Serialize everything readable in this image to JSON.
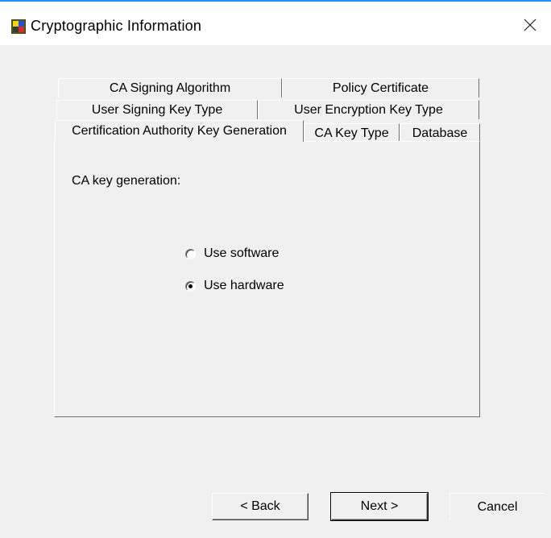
{
  "window": {
    "title": "Cryptographic Information",
    "accent_color": "#1e90ff"
  },
  "tabs": {
    "row1": [
      {
        "label": "CA Signing Algorithm"
      },
      {
        "label": "Policy Certificate"
      }
    ],
    "row2": [
      {
        "label": "User Signing Key Type"
      },
      {
        "label": "User Encryption Key Type"
      }
    ],
    "row3": [
      {
        "label": "Certification Authority Key Generation",
        "selected": true
      },
      {
        "label": "CA Key Type"
      },
      {
        "label": "Database"
      }
    ]
  },
  "panel": {
    "section_label": "CA key generation:",
    "options": [
      {
        "label": "Use software",
        "checked": false
      },
      {
        "label": "Use hardware",
        "checked": true
      }
    ]
  },
  "buttons": {
    "back_label": "< Back",
    "next_label": "Next >",
    "cancel_label": "Cancel"
  }
}
